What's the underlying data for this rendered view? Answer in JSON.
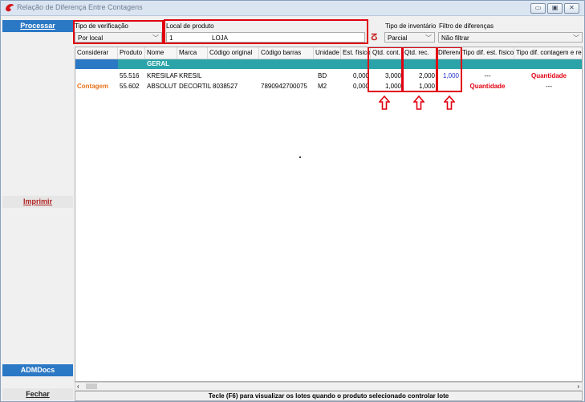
{
  "window": {
    "title": "Relação de Diferença Entre Contagens",
    "buttons": {
      "minimize": "▭",
      "restore": "▣",
      "close": "✕"
    }
  },
  "sidebar": {
    "process_label": "Processar",
    "print_label": "Imprimir",
    "admdocs_label": "ADMDocs",
    "close_label": "Fechar"
  },
  "filters": {
    "verification_type": {
      "label": "Tipo de verificação",
      "value": "Por local"
    },
    "product_location": {
      "label": "Local de produto",
      "code": "1",
      "name": "LOJA"
    },
    "inventory_type": {
      "label": "Tipo de inventário",
      "value": "Parcial"
    },
    "difference_filter": {
      "label": "Filtro de diferenças",
      "value": "Não filtrar"
    }
  },
  "table": {
    "headers": [
      "Considerar",
      "Produto",
      "Nome",
      "Marca",
      "Código original",
      "Código barras",
      "Unidade",
      "Est. físico",
      "Qtd. cont.",
      "Qtd. rec.",
      "Diferença",
      "Tipo dif. est. físico",
      "Tipo dif. contagem e recontagem"
    ],
    "group_label": "GERAL",
    "rows": [
      {
        "considerar": "",
        "produto": "55.516",
        "nome": "KRESILAR",
        "marca": "KRESIL",
        "codigo_original": "",
        "codigo_barras": "",
        "unidade": "BD",
        "est_fisico": "0,000",
        "qtd_cont": "3,000",
        "qtd_rec": "2,000",
        "diferenca": "1,000",
        "tipo_dif_est": "---",
        "tipo_dif_cont": "Quantidade"
      },
      {
        "considerar": "Contagem",
        "produto": "55.602",
        "nome": "ABSOLUT (",
        "marca": "DECORTILES",
        "codigo_original": "8038527",
        "codigo_barras": "7890942700075",
        "unidade": "M2",
        "est_fisico": "0,000",
        "qtd_cont": "1,000",
        "qtd_rec": "1,000",
        "diferenca": "",
        "tipo_dif_est": "Quantidade",
        "tipo_dif_cont": "---"
      }
    ]
  },
  "status_bar": "Tecle (F6) para visualizar os lotes quando o produto selecionado controlar lote",
  "colors": {
    "accent_blue": "#2b78c5",
    "group_teal": "#2aa4a8",
    "highlight_red": "#e00010",
    "orange": "#e8731c"
  }
}
